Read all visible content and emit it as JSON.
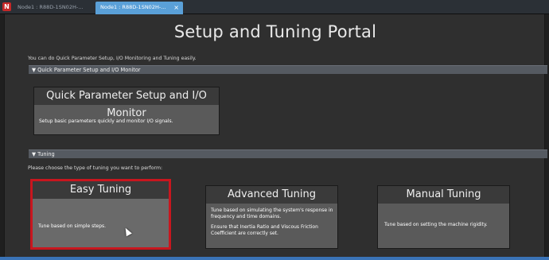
{
  "tabs": [
    {
      "label": "Node1 : R88D-1SN02H-..."
    },
    {
      "label": "Node1 : R88D-1SN02H-...",
      "close": "×"
    }
  ],
  "app": {
    "icon_letter": "N"
  },
  "page": {
    "title": "Setup and Tuning Portal",
    "intro": "You can do Quick Parameter Setup, I/O Monitoring and Tuning easily."
  },
  "sections": {
    "quick": {
      "header": "▼ Quick Parameter Setup and I/O Monitor",
      "card_title": "Quick Parameter Setup and I/O Monitor",
      "card_desc": "Setup basic parameters quickly and monitor I/O signals."
    },
    "tuning": {
      "header": "▼ Tuning",
      "prompt": "Please choose the type of tuning you want to perform:",
      "easy": {
        "title": "Easy Tuning",
        "desc": "Tune based on simple steps."
      },
      "advanced": {
        "title": "Advanced Tuning",
        "desc1": "Tune based on simulating the system's response in frequency and time domains.",
        "desc2": "Ensure that Inertia Ratio and Viscous Friction Coefficient are correctly set."
      },
      "manual": {
        "title": "Manual Tuning",
        "desc": "Tune based on setting the machine rigidity."
      }
    }
  },
  "colors": {
    "background": "#2f2f2f",
    "section_header": "#555a61",
    "card": "#5a5a5a",
    "card_title_bar": "#3a3a3a",
    "highlight": "#c8161e",
    "active_tab": "#5aa0d8"
  },
  "icons": {
    "cursor": "mouse-pointer-icon",
    "collapse": "triangle-down-icon"
  }
}
